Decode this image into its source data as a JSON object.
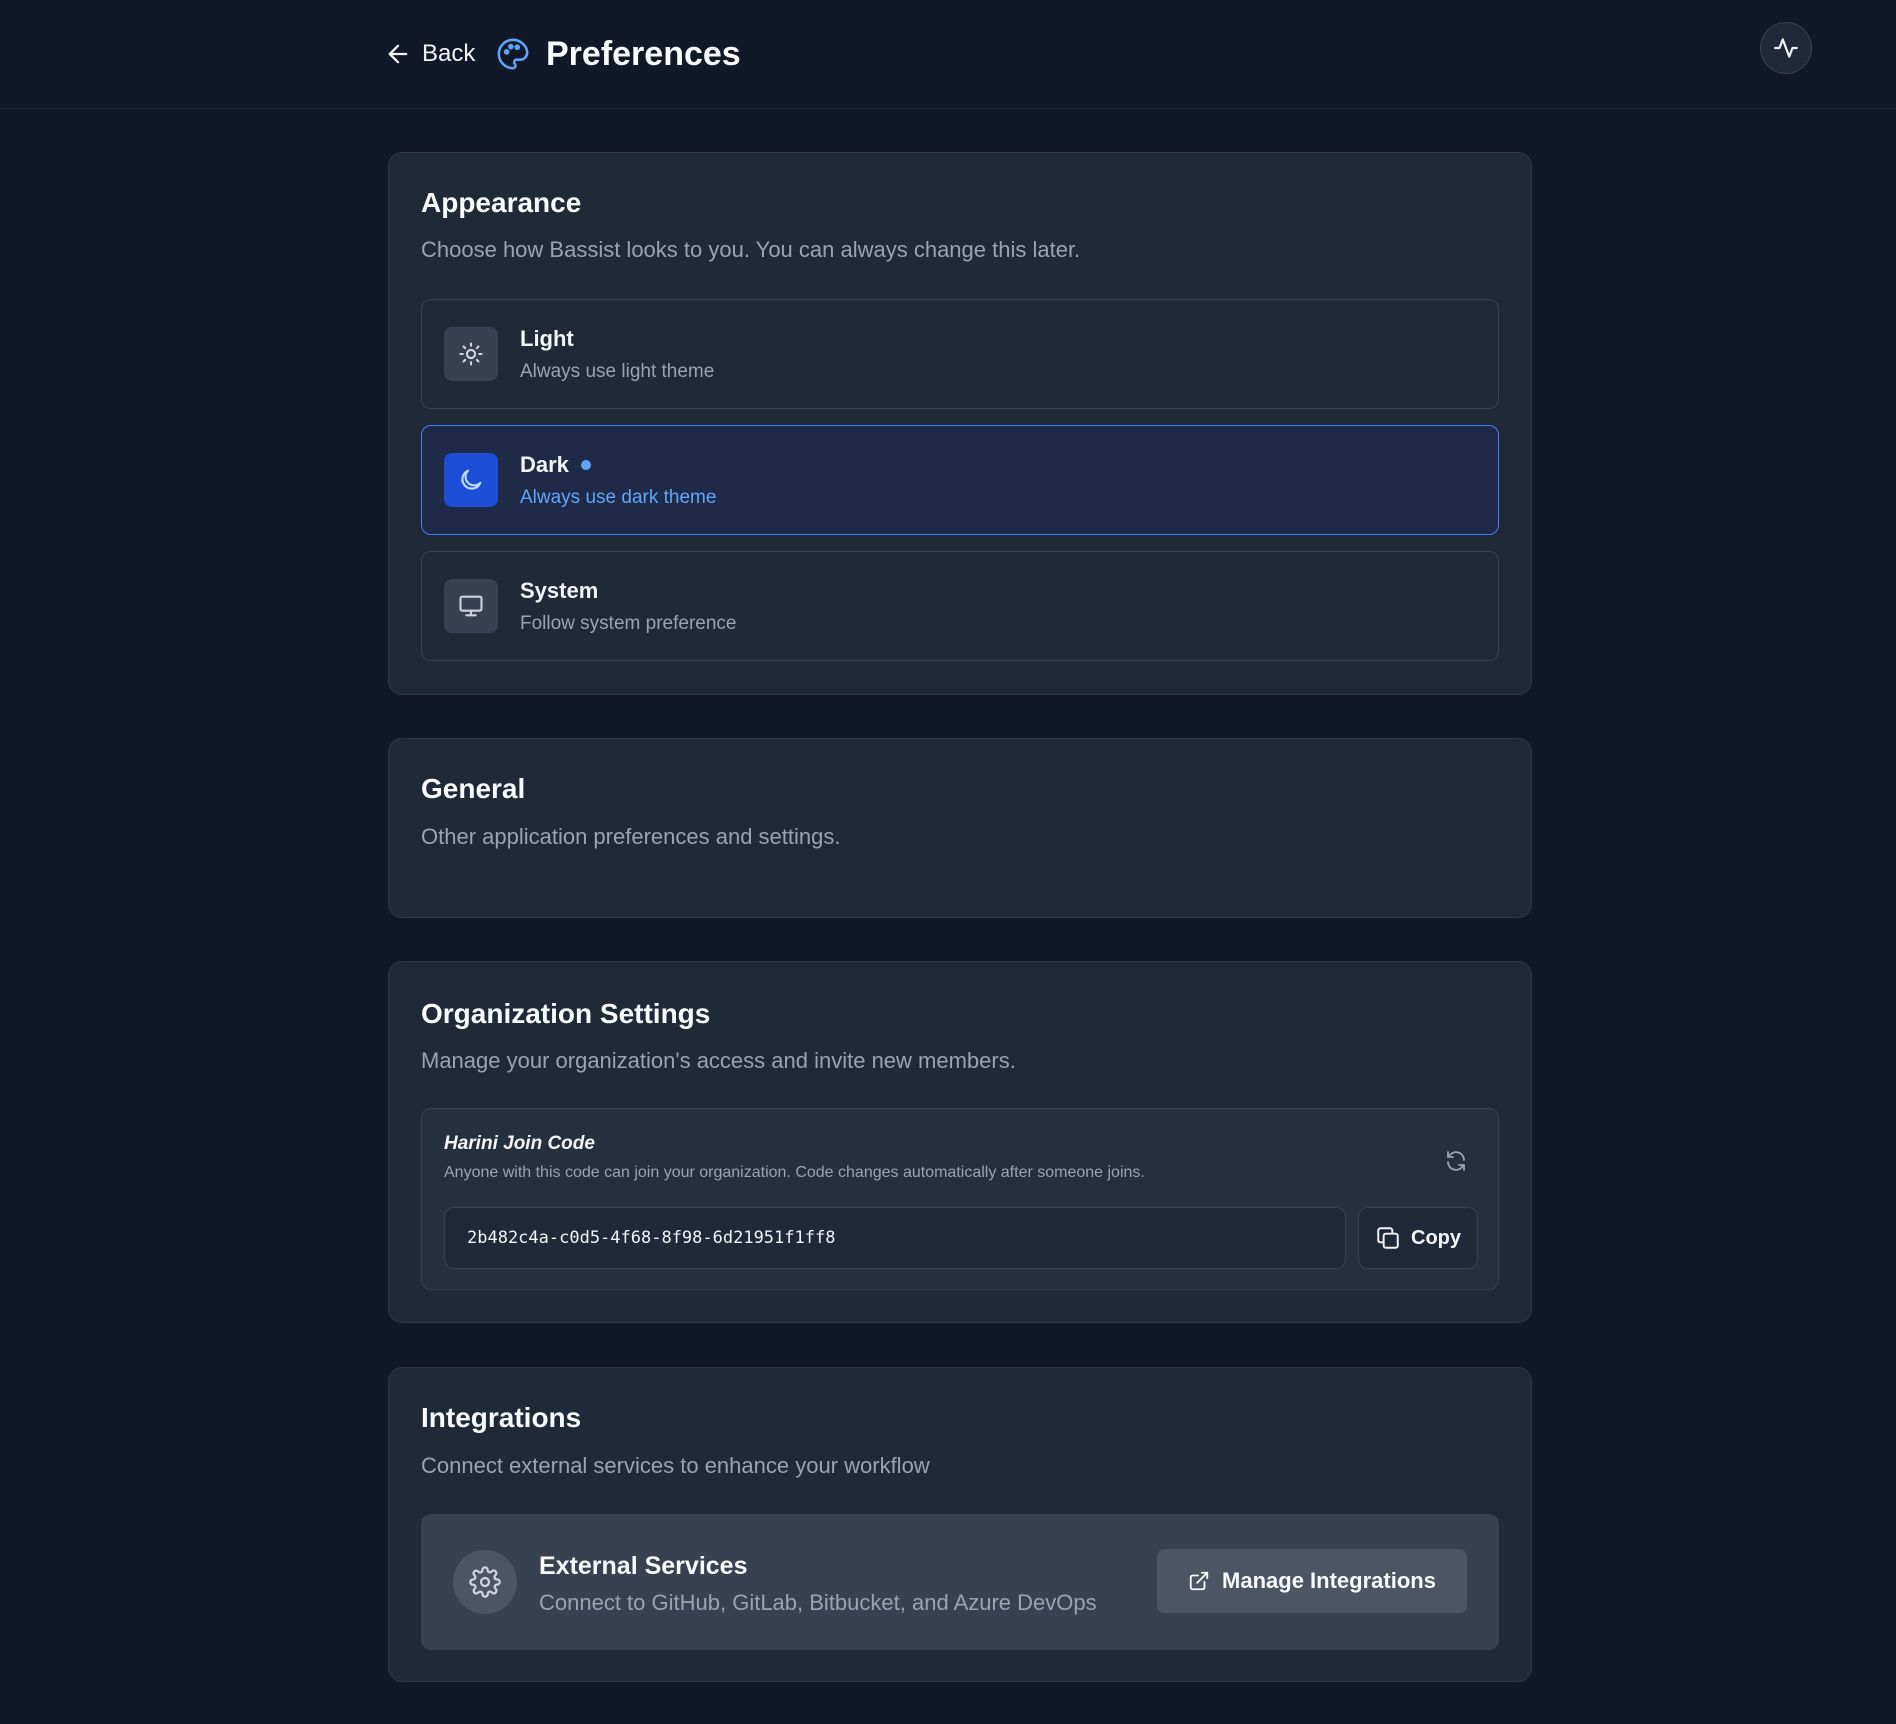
{
  "header": {
    "back_label": "Back",
    "title": "Preferences",
    "icons": {
      "back": "arrow-left-icon",
      "title": "palette-icon",
      "activity": "activity-icon"
    }
  },
  "appearance": {
    "title": "Appearance",
    "description": "Choose how Bassist looks to you. You can always change this later.",
    "selected": "Dark",
    "options": [
      {
        "label": "Light",
        "sub": "Always use light theme",
        "icon": "sun-icon"
      },
      {
        "label": "Dark",
        "sub": "Always use dark theme",
        "icon": "moon-icon"
      },
      {
        "label": "System",
        "sub": "Follow system preference",
        "icon": "monitor-icon"
      }
    ]
  },
  "general": {
    "title": "General",
    "description": "Other application preferences and settings."
  },
  "organization": {
    "title": "Organization Settings",
    "description": "Manage your organization's access and invite new members.",
    "join_title": "Harini Join Code",
    "join_description": "Anyone with this code can join your organization. Code changes automatically after someone joins.",
    "join_code": "2b482c4a-c0d5-4f68-8f98-6d21951f1ff8",
    "copy_label": "Copy"
  },
  "integrations": {
    "title": "Integrations",
    "description": "Connect external services to enhance your workflow",
    "external_title": "External Services",
    "external_description": "Connect to GitHub, GitLab, Bitbucket, and Azure DevOps",
    "manage_label": "Manage Integrations"
  },
  "colors": {
    "background": "#111827",
    "card": "#1f2937",
    "accent": "#3b82f6",
    "accent_text": "#60a5fa",
    "muted_text": "#9ca3af"
  }
}
